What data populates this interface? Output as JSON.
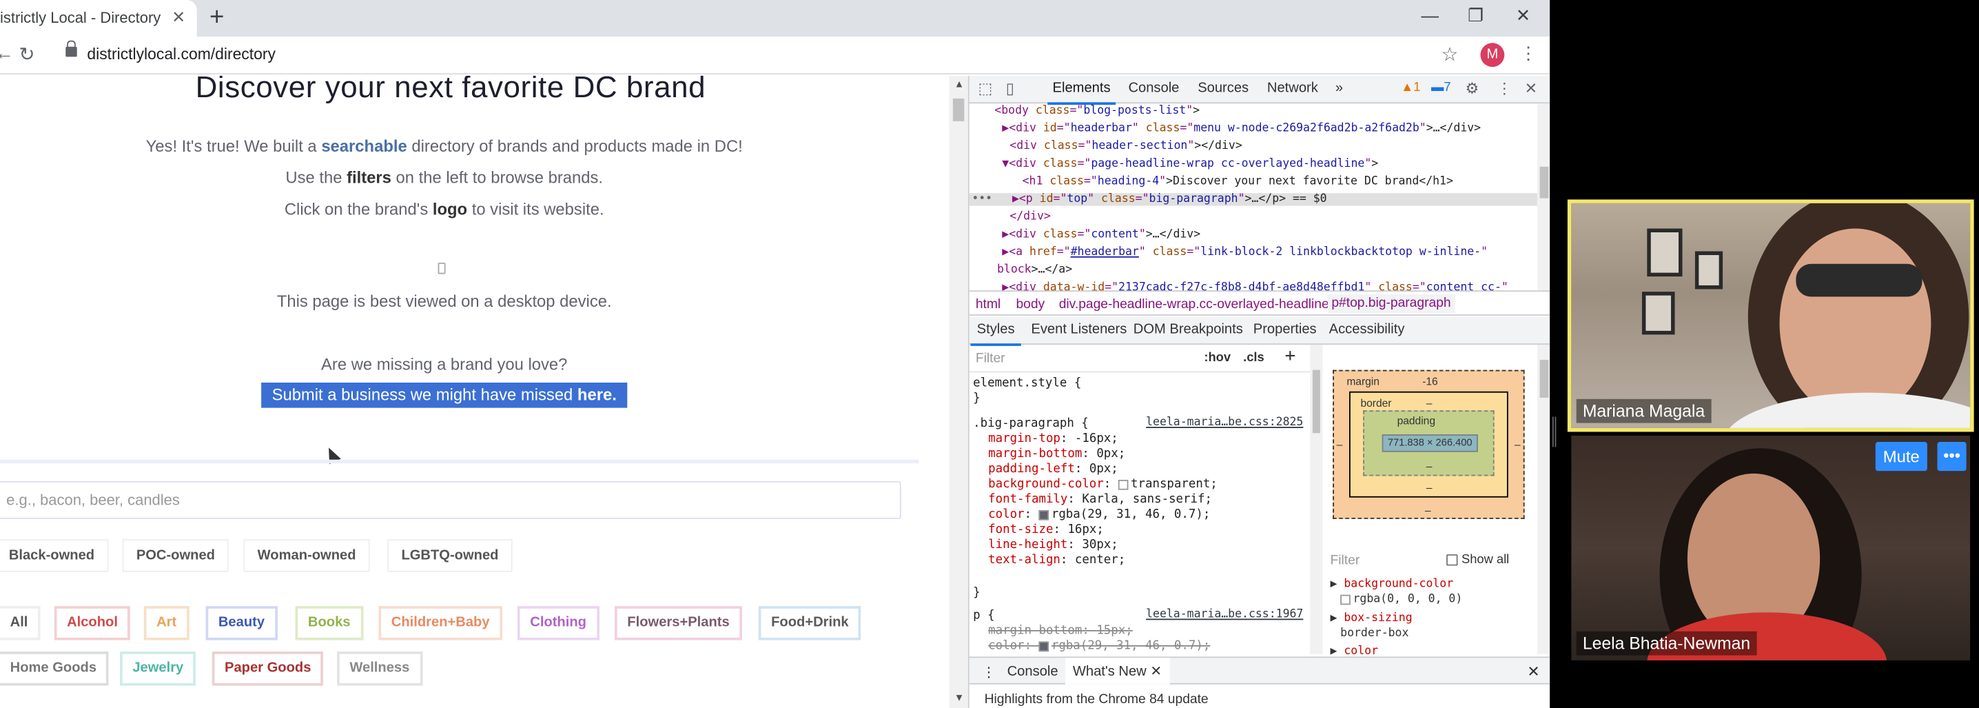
{
  "browser": {
    "tab_title": "istrictly Local - Directory",
    "url": "districtlylocal.com/directory",
    "profile_initial": "M",
    "icons": {
      "tab_close": "close-icon",
      "new_tab": "plus-icon",
      "back": "arrow-left-icon",
      "reload": "reload-icon",
      "bookmark": "star-icon",
      "menu": "kebab-icon"
    }
  },
  "page": {
    "headline": "Discover your next favorite DC brand",
    "intro_pre": "Yes! It's true! We built a ",
    "intro_link": "searchable",
    "intro_post": " directory of brands and products made in DC!",
    "filters_pre": "Use the ",
    "filters_bold": "filters",
    "filters_post": " on the left to browse brands.",
    "logo_pre": "Click on the brand's ",
    "logo_bold": "logo",
    "logo_post": " to visit its website.",
    "desktop_note": "This page is best viewed on a desktop device.",
    "missing": "Are we missing a brand you love?",
    "submit_pre": "Submit a business we might have missed ",
    "submit_bold": "here.",
    "search_placeholder": "e.g., bacon, beer, candles",
    "owner_filters": [
      "Black-owned",
      "POC-owned",
      "Woman-owned",
      "LGBTQ-owned"
    ],
    "categories": [
      {
        "label": "All",
        "color": "#555555",
        "border": "#eeeeee"
      },
      {
        "label": "Alcohol",
        "color": "#d04a4a",
        "border": "#f3d0d0"
      },
      {
        "label": "Art",
        "color": "#e8a45a",
        "border": "#f6e0c6"
      },
      {
        "label": "Beauty",
        "color": "#3a58b5",
        "border": "#cfd8f3"
      },
      {
        "label": "Books",
        "color": "#8fb34a",
        "border": "#deebc8"
      },
      {
        "label": "Children+Baby",
        "color": "#e78a62",
        "border": "#f7dcd0"
      },
      {
        "label": "Clothing",
        "color": "#b063c7",
        "border": "#ead6f1"
      },
      {
        "label": "Flowers+Plants",
        "color": "#7a5a6c",
        "border": "#f3cfe0"
      },
      {
        "label": "Food+Drink",
        "color": "#5a5a5a",
        "border": "#cfe3f3"
      },
      {
        "label": "Home Goods",
        "color": "#777777",
        "border": "#dcdcdc"
      },
      {
        "label": "Jewelry",
        "color": "#4bb5a5",
        "border": "#cdece7"
      },
      {
        "label": "Paper Goods",
        "color": "#a83232",
        "border": "#eccfcf"
      },
      {
        "label": "Wellness",
        "color": "#888888",
        "border": "#e2e2e2"
      }
    ]
  },
  "devtools": {
    "tabs": [
      "Elements",
      "Console",
      "Sources",
      "Network",
      "»"
    ],
    "warnings": "1",
    "messages": "7",
    "dom_lines": [
      {
        "tag": "<body ",
        "attrs": [
          [
            "class",
            "blog-posts-list"
          ]
        ],
        "text": ">"
      },
      {
        "tag": "▶<div ",
        "attrs": [
          [
            "id",
            "headerbar"
          ],
          [
            "class",
            "menu w-node-c269a2f6ad2b-a2f6ad2b"
          ]
        ],
        "text": ">…</div>"
      },
      {
        "tag": "<div ",
        "attrs": [
          [
            "class",
            "header-section"
          ]
        ],
        "text": "></div>"
      },
      {
        "tag": "▼<div ",
        "attrs": [
          [
            "class",
            "page-headline-wrap cc-overlayed-headline"
          ]
        ],
        "text": ">"
      },
      {
        "tag": "<h1 ",
        "attrs": [
          [
            "class",
            "heading-4"
          ]
        ],
        "text": ">Discover your next favorite DC brand</h1>"
      },
      {
        "tag": "▶<p ",
        "attrs": [
          [
            "id",
            "top"
          ],
          [
            "class",
            "big-paragraph"
          ]
        ],
        "text": ">…</p> == $0"
      },
      {
        "tag": "</div>",
        "attrs": [],
        "text": ""
      },
      {
        "tag": "▶<div ",
        "attrs": [
          [
            "class",
            "content"
          ]
        ],
        "text": ">…</div>"
      },
      {
        "tag": "▶<a ",
        "attrs": [
          [
            "href",
            "#headerbar"
          ],
          [
            "class",
            "link-block-2 linkblockbacktotop w-inline-"
          ]
        ],
        "text": ""
      },
      {
        "tag": "block",
        "attrs": [],
        "text": ">…</a>"
      },
      {
        "tag": "▶<div ",
        "attrs": [
          [
            "data-w-id",
            "2137cadc-f27c-f8b8-d4bf-ae8d48effbd1"
          ],
          [
            "class",
            "content cc-"
          ]
        ],
        "text": ""
      }
    ],
    "breadcrumbs": [
      "html",
      "body",
      "div.page-headline-wrap.cc-overlayed-headline",
      "p#top.big-paragraph"
    ],
    "subtabs": [
      "Styles",
      "Event Listeners",
      "DOM Breakpoints",
      "Properties",
      "Accessibility"
    ],
    "styles_filter": "Filter",
    "hov": ":hov",
    "cls": ".cls",
    "element_style": "element.style {",
    "rule_selector": ".big-paragraph {",
    "rule_source": "leela-maria…be.css:2825",
    "rule_props": [
      [
        "margin-top",
        "-16px;"
      ],
      [
        "margin-bottom",
        "0px;"
      ],
      [
        "padding-left",
        "0px;"
      ],
      [
        "background-color",
        "transparent;"
      ],
      [
        "font-family",
        "Karla, sans-serif;"
      ],
      [
        "color",
        "rgba(29, 31, 46, 0.7);"
      ],
      [
        "font-size",
        "16px;"
      ],
      [
        "line-height",
        "30px;"
      ],
      [
        "text-align",
        "center;"
      ]
    ],
    "p_selector": "p {",
    "p_source": "leela-maria…be.css:1967",
    "p_props": [
      [
        "margin-bottom",
        "15px;"
      ],
      [
        "color",
        "rgba(29, 31, 46, 0.7);"
      ]
    ],
    "box_model": {
      "margin_label": "margin",
      "margin_top": "-16",
      "border_label": "border",
      "padding_label": "padding",
      "content": "771.838 × 266.400",
      "dash": "–"
    },
    "computed_filter": "Filter",
    "show_all": "Show all",
    "computed": [
      {
        "name": "background-color",
        "value": "rgba(0, 0, 0, 0)"
      },
      {
        "name": "box-sizing",
        "value": "border-box"
      },
      {
        "name": "color",
        "value": ""
      }
    ],
    "drawer_tabs": [
      "Console",
      "What's New"
    ],
    "drawer_text": "Highlights from the Chrome 84 update"
  },
  "video": {
    "participant1": "Mariana Magala",
    "participant2": "Leela Bhatia-Newman",
    "mute_label": "Mute",
    "more_label": "•••"
  }
}
